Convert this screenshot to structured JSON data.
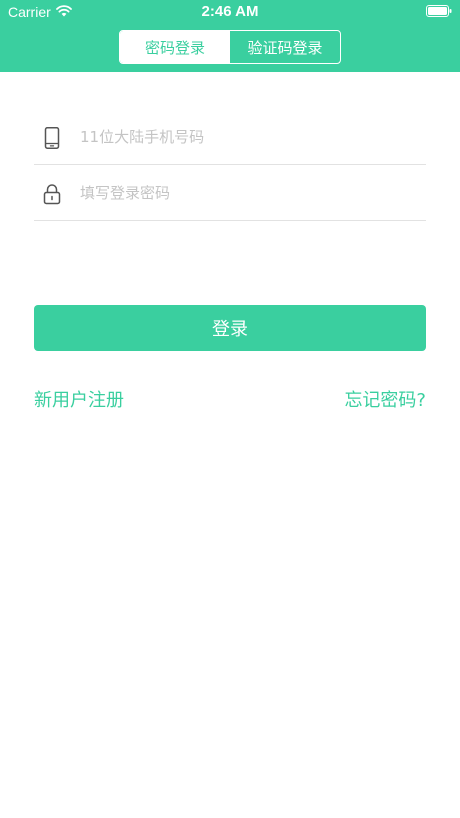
{
  "status_bar": {
    "carrier": "Carrier",
    "time": "2:46 AM"
  },
  "tabs": {
    "password_login": "密码登录",
    "code_login": "验证码登录",
    "active": "password_login"
  },
  "form": {
    "phone_placeholder": "11位大陆手机号码",
    "phone_value": "",
    "password_placeholder": "填写登录密码",
    "password_value": ""
  },
  "login_button": "登录",
  "links": {
    "register": "新用户注册",
    "forgot_password": "忘记密码?"
  },
  "icons": {
    "phone": "phone-icon",
    "lock": "lock-icon",
    "wifi": "wifi-icon",
    "battery": "battery-icon"
  },
  "colors": {
    "accent": "#3acf9f",
    "divider": "#e2e2e2",
    "placeholder": "#c4c4c4"
  }
}
